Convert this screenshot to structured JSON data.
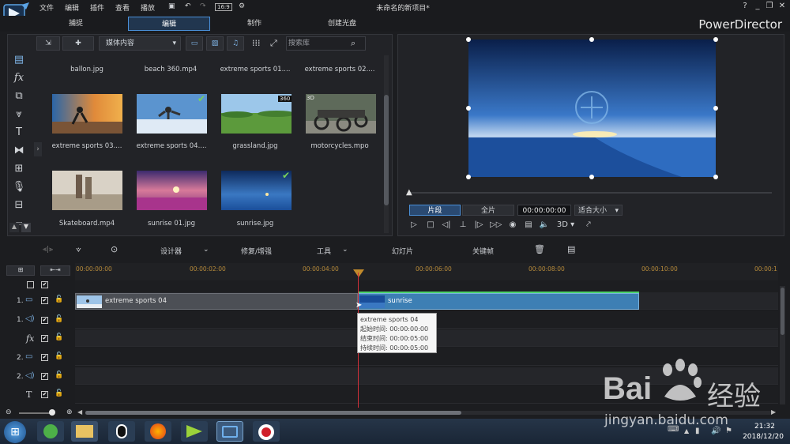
{
  "app": {
    "title": "未命名的新项目*",
    "brand": "PowerDirector",
    "menu": [
      "文件",
      "编辑",
      "插件",
      "查看",
      "播放"
    ],
    "winControls": [
      "?",
      "_",
      "❐",
      "✕"
    ]
  },
  "modeTabs": [
    "捕捉",
    "编辑",
    "制作",
    "创建光盘"
  ],
  "activeModeTab": "编辑",
  "library": {
    "dropdown": "媒体内容",
    "searchPlaceholder": "搜索库",
    "topRow": [
      "ballon.jpg",
      "beach 360.mp4",
      "extreme sports 01....",
      "extreme sports 02...."
    ],
    "items": [
      {
        "name": "extreme sports 03....",
        "badge": "",
        "checked": false
      },
      {
        "name": "extreme sports 04....",
        "badge": "",
        "checked": true
      },
      {
        "name": "grassland.jpg",
        "badge": "360",
        "checked": false
      },
      {
        "name": "motorcycles.mpo",
        "badge": "3D",
        "checked": false
      },
      {
        "name": "Skateboard.mp4",
        "badge": "",
        "checked": false
      },
      {
        "name": "sunrise 01.jpg",
        "badge": "",
        "checked": false
      },
      {
        "name": "sunrise.jpg",
        "badge": "",
        "checked": true
      }
    ],
    "sideIcons": [
      "media-room-icon",
      "fx-icon",
      "pip-icon",
      "particle-icon",
      "title-icon",
      "transition-icon",
      "audio-mix-icon",
      "voice-over-icon",
      "chapter-icon",
      "subtitle-icon"
    ]
  },
  "preview": {
    "tabs": [
      "片段",
      "全片"
    ],
    "timecode": "00:00:00:00",
    "zoom": "适合大小",
    "mode3d": "3D"
  },
  "timelineToolbar": {
    "design": "设计器",
    "repair": "修复/增强",
    "tools": "工具",
    "slideshow": "幻灯片",
    "keyframe": "关键帧"
  },
  "ruler": [
    "00:00:00:00",
    "00:00:02:00",
    "00:00:04:00",
    "00:00:06:00",
    "00:00:08:00",
    "00:00:10:00",
    "00:00:1"
  ],
  "tracks": [
    {
      "label": "",
      "type": "master"
    },
    {
      "label": "1.",
      "type": "video"
    },
    {
      "label": "1.",
      "type": "audio"
    },
    {
      "label": "fx",
      "type": "fx"
    },
    {
      "label": "2.",
      "type": "video"
    },
    {
      "label": "2.",
      "type": "audio"
    },
    {
      "label": "T",
      "type": "title"
    }
  ],
  "clips": {
    "clip1": "extreme sports 04",
    "clip2": "sunrise"
  },
  "tooltip": {
    "title": "extreme sports 04",
    "start": "起始时间: 00:00:00:00",
    "end": "结束时间: 00:00:05:00",
    "duration": "持续时间:  00:00:05:00"
  },
  "taskbar": {
    "time": "21:32",
    "date": "2018/12/20"
  },
  "watermark": {
    "brand": "Bai",
    "cn": "经验",
    "url": "jingyan.baidu.com"
  },
  "colors": {
    "accent": "#4a90d9",
    "playhead": "#d0303a",
    "videoClip": "#3d7fb4"
  }
}
